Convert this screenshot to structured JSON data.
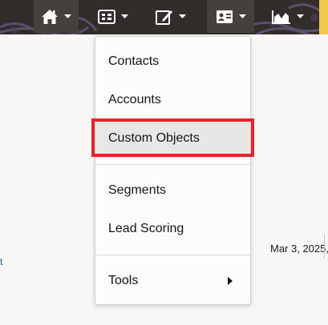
{
  "nav": {
    "items": [
      {
        "name": "home",
        "icon": "home-icon",
        "active": true
      },
      {
        "name": "orchestration",
        "icon": "flow-icon",
        "active": false
      },
      {
        "name": "assets",
        "icon": "pencil-icon",
        "active": false
      },
      {
        "name": "audience",
        "icon": "contact-card-icon",
        "active": true
      },
      {
        "name": "insight",
        "icon": "area-chart-icon",
        "active": false
      }
    ]
  },
  "dropdown": {
    "items": [
      {
        "label": "Contacts"
      },
      {
        "label": "Accounts"
      },
      {
        "label": "Custom Objects",
        "highlighted": true
      },
      {
        "label": "Segments"
      },
      {
        "label": "Lead Scoring"
      },
      {
        "label": "Tools",
        "has_submenu": true
      }
    ]
  },
  "background": {
    "date_text": "Mar 3, 2025,",
    "link_fragment": "t"
  },
  "colors": {
    "topbar": "#312d2a",
    "highlight_border": "#e2262b",
    "link": "#0b6ba8"
  }
}
